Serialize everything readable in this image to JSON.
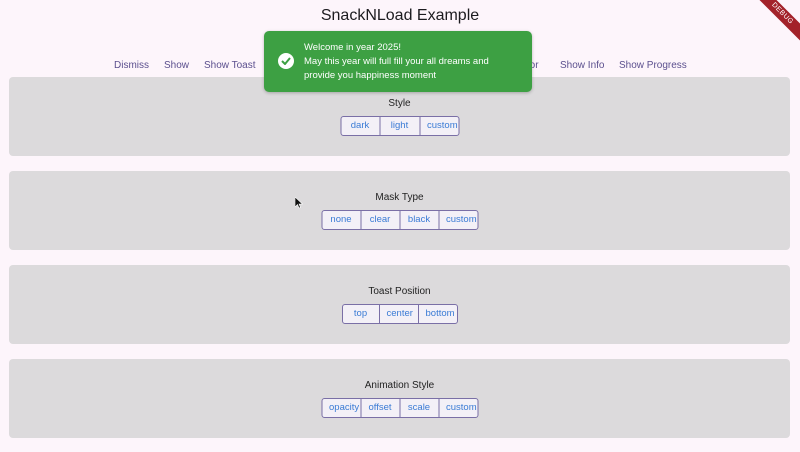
{
  "app_title": "SnackNLoad Example",
  "debug_banner": "DEBUG",
  "actions": [
    "Dismiss",
    "Show",
    "Show Toast",
    "rror",
    "Show Info",
    "Show Progress"
  ],
  "toast": {
    "line1": "Welcome in year 2025!",
    "line2": "May this year will full fill your all dreams and",
    "line3": "provide you happiness moment",
    "icon": "check-circle-icon",
    "color": "#3da043"
  },
  "sections": {
    "style": {
      "title": "Style",
      "options": [
        "dark",
        "light",
        "custom"
      ]
    },
    "mask": {
      "title": "Mask Type",
      "options": [
        "none",
        "clear",
        "black",
        "custom"
      ]
    },
    "position": {
      "title": "Toast Position",
      "options": [
        "top",
        "center",
        "bottom"
      ]
    },
    "animation": {
      "title": "Animation Style",
      "options": [
        "opacity",
        "offset",
        "scale",
        "custom"
      ]
    }
  },
  "colors": {
    "background": "#fdf5fb",
    "section": "#dcdadc",
    "accent": "#5b4f8e",
    "option_text": "#3a7bd5"
  }
}
